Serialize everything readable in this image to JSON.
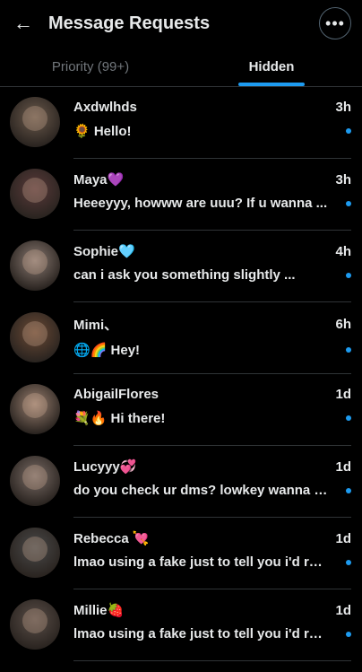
{
  "header": {
    "title": "Message Requests",
    "back_icon": "←",
    "more_icon": "•••"
  },
  "tabs": [
    {
      "label": "Priority (99+)",
      "active": false
    },
    {
      "label": "Hidden",
      "active": true
    }
  ],
  "colors": {
    "accent": "#1d9bf0",
    "background": "#000000",
    "text": "#e7e9ea",
    "muted": "#71767b"
  },
  "messages": [
    {
      "name": "Axdwlhds",
      "time": "3h",
      "preview": "🌻 Hello!",
      "unread": true,
      "avatar_color": "#6b5a4c"
    },
    {
      "name": "Maya💜",
      "time": "3h",
      "preview": "Heeeyyy, howww are uuu? If u wanna ...",
      "unread": true,
      "avatar_color": "#5a3a3a"
    },
    {
      "name": "Sophie🩵",
      "time": "4h",
      "preview": "can i ask you something slightly ...",
      "unread": true,
      "avatar_color": "#8a7a72"
    },
    {
      "name": "Mimi、",
      "time": "6h",
      "preview": "🌐🌈 Hey!",
      "unread": true,
      "avatar_color": "#6b4a35"
    },
    {
      "name": "AbigailFlores",
      "time": "1d",
      "preview": "💐🔥 Hi there!",
      "unread": true,
      "avatar_color": "#9a8070"
    },
    {
      "name": "Lucyyy💞",
      "time": "1d",
      "preview": "do you check ur dms? lowkey wanna ta...",
      "unread": true,
      "avatar_color": "#7a6c66"
    },
    {
      "name": "Rebecca 💘",
      "time": "1d",
      "preview": "lmao using a fake just to tell you i'd ruin...",
      "unread": true,
      "avatar_color": "#4a4a4a"
    },
    {
      "name": "Millie🍓",
      "time": "1d",
      "preview": "lmao using a fake just to tell you i'd ruin...",
      "unread": true,
      "avatar_color": "#5a4e48"
    }
  ]
}
